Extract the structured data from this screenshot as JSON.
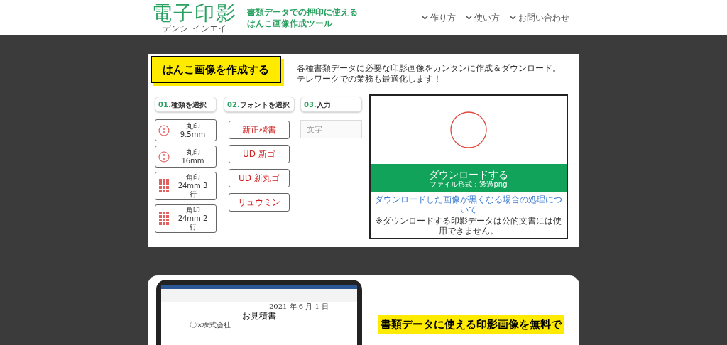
{
  "header": {
    "logo": "電子印影",
    "logo_reading": "デンシ_インエイ",
    "tagline": [
      "書類データでの押印に使える",
      "はんこ画像作成ツール"
    ],
    "nav": [
      {
        "label": "作り方"
      },
      {
        "label": "使い方"
      },
      {
        "label": "お問い合わせ"
      }
    ]
  },
  "maker": {
    "title": "はんこ画像を作成する",
    "description": [
      "各種書類データに必要な印影画像をカンタンに作成＆ダウンロード。",
      "テレワークでの業務も最適化します！"
    ],
    "steps": [
      {
        "number": "01.",
        "label": "種類を選択"
      },
      {
        "number": "02.",
        "label": "フォントを選択"
      },
      {
        "number": "03.",
        "label": "入力"
      }
    ],
    "types": [
      {
        "kind": "round",
        "label": "丸印\n9.5mm"
      },
      {
        "kind": "round",
        "label": "丸印\n16mm"
      },
      {
        "kind": "square",
        "label": "角印\n24mm 3\n行"
      },
      {
        "kind": "square",
        "label": "角印\n24mm 2\n行"
      }
    ],
    "fonts": [
      {
        "label": "新正楷書"
      },
      {
        "label": "UD 新ゴ"
      },
      {
        "label": "UD 新丸ゴ"
      },
      {
        "label": "リュウミン"
      }
    ],
    "input": {
      "placeholder": "文字"
    },
    "download": {
      "label": "ダウンロードする",
      "format": "ファイル形式：透過png",
      "help_link": "ダウンロードした画像が黒くなる場合の処理について",
      "note": "※ダウンロードする印影データは公的文書には使用できません。"
    }
  },
  "feature": {
    "document": {
      "date": "2021 年 6 月 1 日",
      "title": "お見積書",
      "company": "〇×株式会社"
    },
    "headline": "書類データに使える印影画像を**無料**で"
  }
}
